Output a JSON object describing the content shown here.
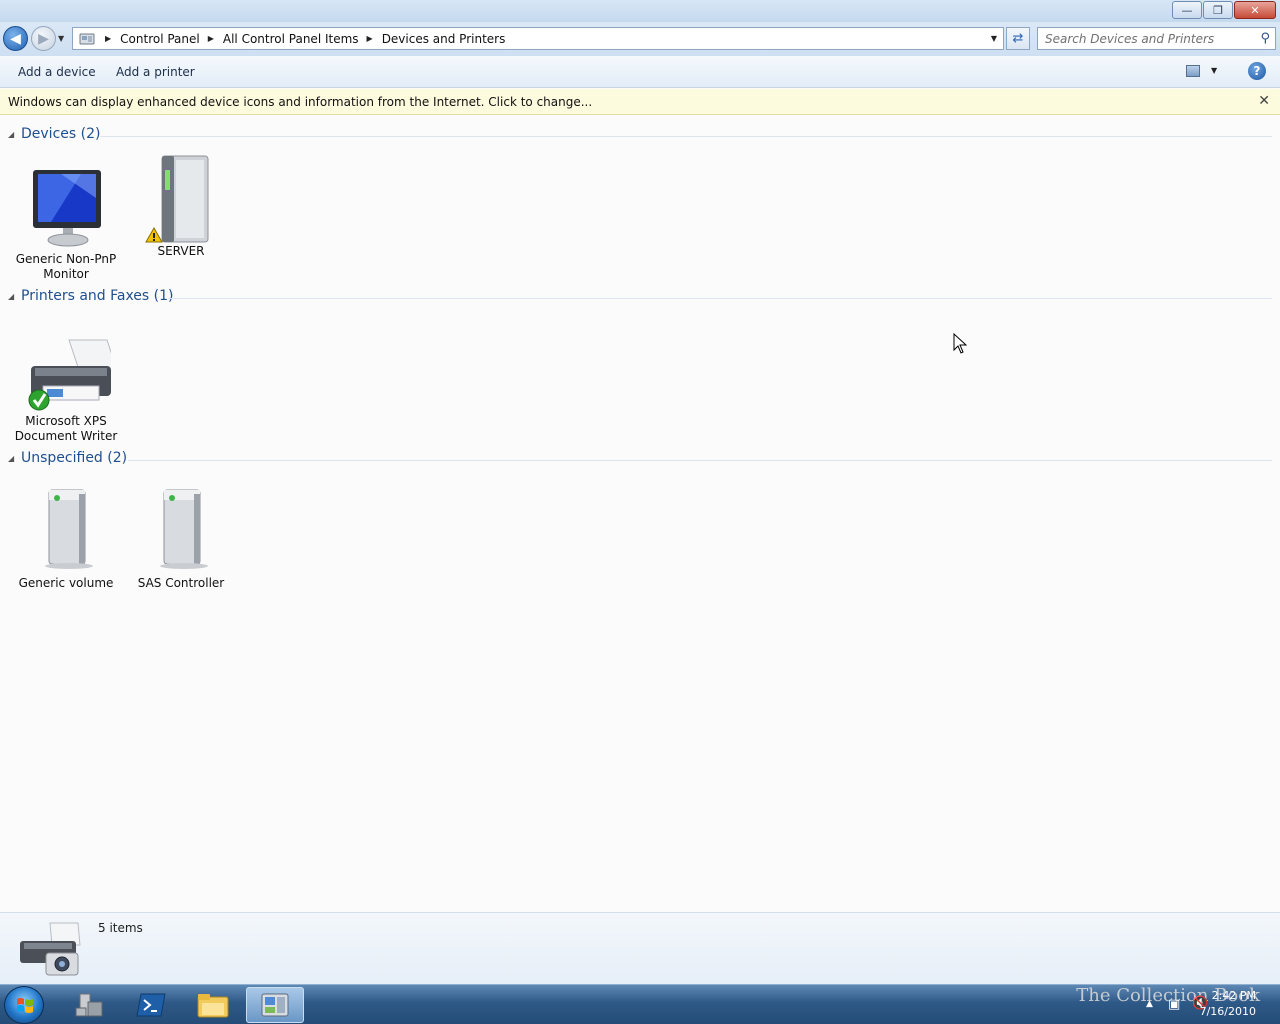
{
  "window": {
    "minimize": "—",
    "restore": "❐",
    "close": "✕"
  },
  "address": {
    "crumbs": [
      "Control Panel",
      "All Control Panel Items",
      "Devices and Printers"
    ]
  },
  "search": {
    "placeholder": "Search Devices and Printers"
  },
  "toolbar": {
    "add_device": "Add a device",
    "add_printer": "Add a printer",
    "help": "?"
  },
  "infobar": {
    "text": "Windows can display enhanced device icons and information from the Internet. Click to change...",
    "close": "✕"
  },
  "groups": {
    "devices": {
      "title": "Devices (2)",
      "items": [
        {
          "label": "Generic Non-PnP Monitor",
          "icon": "monitor-icon"
        },
        {
          "label": "SERVER",
          "icon": "server-icon",
          "badge": "warning"
        }
      ]
    },
    "printers": {
      "title": "Printers and Faxes (1)",
      "items": [
        {
          "label": "Microsoft XPS Document Writer",
          "icon": "printer-icon",
          "badge": "default"
        }
      ]
    },
    "unspecified": {
      "title": "Unspecified (2)",
      "items": [
        {
          "label": "Generic volume",
          "icon": "drive-icon"
        },
        {
          "label": "SAS Controller",
          "icon": "drive-icon"
        }
      ]
    }
  },
  "status": {
    "count": "5 items"
  },
  "taskbar": {
    "watermark": "The Collection Book",
    "time": "2:42 PM",
    "date": "7/16/2010"
  },
  "colors": {
    "group_title": "#1e4f8f",
    "infobar_bg": "#fdfbde",
    "taskbar": "#2e5987"
  }
}
